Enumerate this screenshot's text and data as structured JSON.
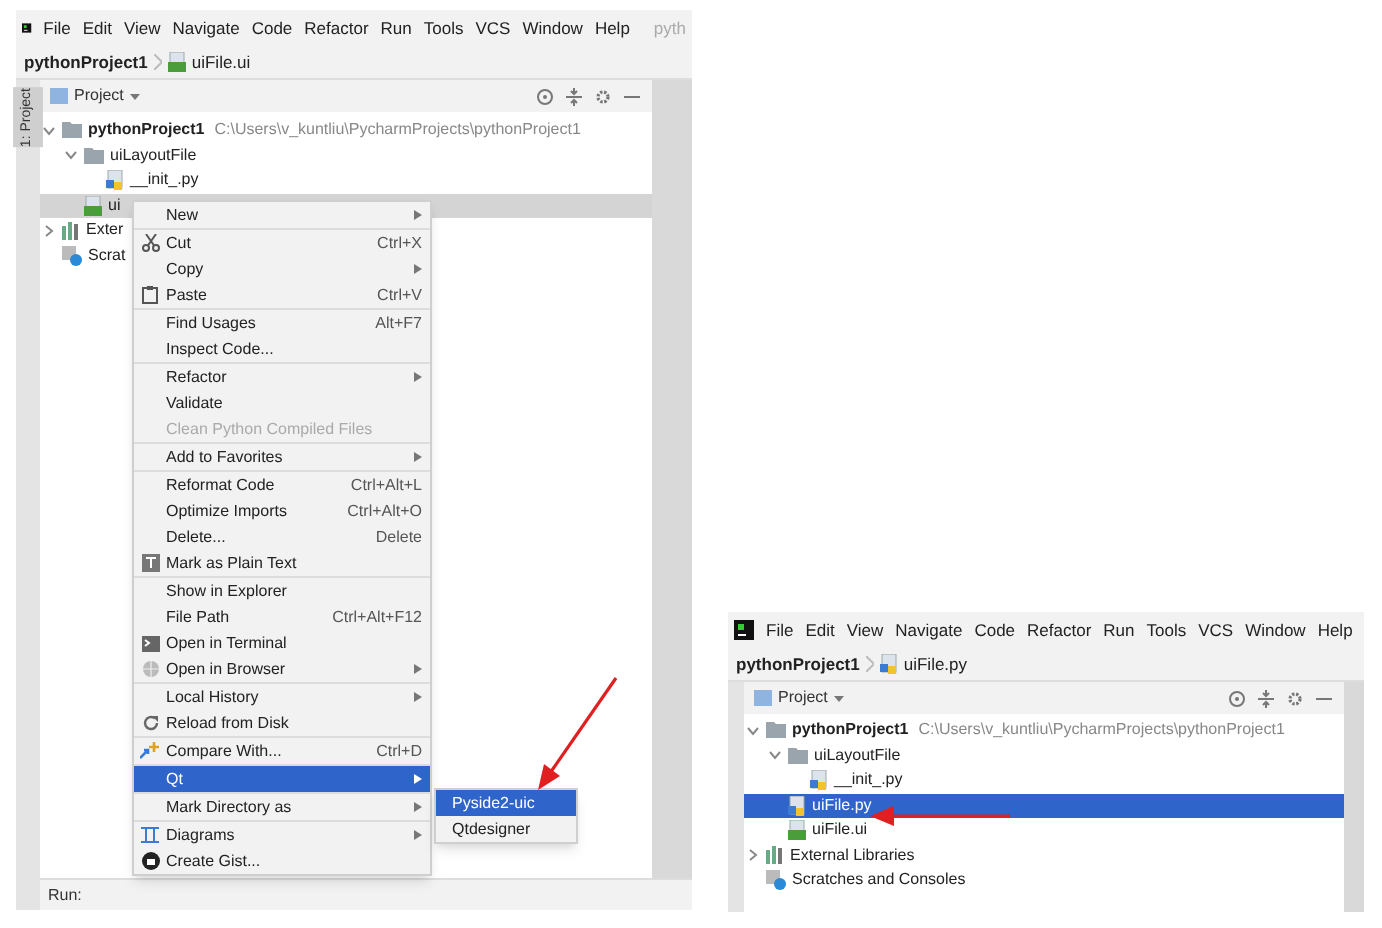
{
  "left_window": {
    "menu_bar": [
      "File",
      "Edit",
      "View",
      "Navigate",
      "Code",
      "Refactor",
      "Run",
      "Tools",
      "VCS",
      "Window",
      "Help",
      "pyth"
    ],
    "breadcrumb": {
      "project": "pythonProject1",
      "file": "uiFile.ui"
    },
    "side_tab": "1: Project",
    "panel_title": "Project",
    "tree": [
      {
        "label": "pythonProject1",
        "path": "C:\\Users\\v_kuntliu\\PycharmProjects\\pythonProject1",
        "kind": "folder",
        "expanded": true,
        "selected": false,
        "children": [
          {
            "label": "uiLayoutFile",
            "kind": "folder",
            "expanded": true,
            "selected": false,
            "children": [
              {
                "label": "__init_.py",
                "kind": "python",
                "selected": false
              }
            ]
          },
          {
            "label": "ui",
            "kind": "ui",
            "selected": true
          }
        ]
      },
      {
        "label": "Exter",
        "kind": "library",
        "expanded": false,
        "selected": false
      },
      {
        "label": "Scrat",
        "kind": "scratch",
        "selected": false
      }
    ],
    "context_menu": [
      [
        {
          "label": "New",
          "submenu": true,
          "disabled": false,
          "selected": false
        }
      ],
      [
        {
          "label": "Cut",
          "shortcut": "Ctrl+X",
          "kind": "scissors",
          "submenu": false,
          "disabled": false,
          "selected": false
        },
        {
          "label": "Copy",
          "submenu": true,
          "disabled": false,
          "selected": false
        },
        {
          "label": "Paste",
          "shortcut": "Ctrl+V",
          "kind": "clipboard",
          "submenu": false,
          "disabled": false,
          "selected": false
        }
      ],
      [
        {
          "label": "Find Usages",
          "shortcut": "Alt+F7",
          "submenu": false,
          "disabled": false,
          "selected": false
        },
        {
          "label": "Inspect Code...",
          "submenu": false,
          "disabled": false,
          "selected": false
        }
      ],
      [
        {
          "label": "Refactor",
          "submenu": true,
          "disabled": false,
          "selected": false
        },
        {
          "label": "Validate",
          "submenu": false,
          "disabled": false,
          "selected": false
        },
        {
          "label": "Clean Python Compiled Files",
          "submenu": false,
          "disabled": true,
          "selected": false
        }
      ],
      [
        {
          "label": "Add to Favorites",
          "submenu": true,
          "disabled": false,
          "selected": false
        }
      ],
      [
        {
          "label": "Reformat Code",
          "shortcut": "Ctrl+Alt+L",
          "submenu": false,
          "disabled": false,
          "selected": false
        },
        {
          "label": "Optimize Imports",
          "shortcut": "Ctrl+Alt+O",
          "submenu": false,
          "disabled": false,
          "selected": false
        },
        {
          "label": "Delete...",
          "shortcut": "Delete",
          "submenu": false,
          "disabled": false,
          "selected": false
        },
        {
          "label": "Mark as Plain Text",
          "kind": "text",
          "submenu": false,
          "disabled": false,
          "selected": false
        }
      ],
      [
        {
          "label": "Show in Explorer",
          "submenu": false,
          "disabled": false,
          "selected": false
        },
        {
          "label": "File Path",
          "shortcut": "Ctrl+Alt+F12",
          "submenu": false,
          "disabled": false,
          "selected": false
        },
        {
          "label": "Open in Terminal",
          "kind": "terminal",
          "submenu": false,
          "disabled": false,
          "selected": false
        },
        {
          "label": "Open in Browser",
          "kind": "globe",
          "submenu": true,
          "disabled": false,
          "selected": false
        }
      ],
      [
        {
          "label": "Local History",
          "submenu": true,
          "disabled": false,
          "selected": false
        },
        {
          "label": "Reload from Disk",
          "kind": "reload",
          "submenu": false,
          "disabled": false,
          "selected": false
        }
      ],
      [
        {
          "label": "Compare With...",
          "shortcut": "Ctrl+D",
          "kind": "compare",
          "submenu": false,
          "disabled": false,
          "selected": false
        }
      ],
      [
        {
          "label": "Qt",
          "submenu": true,
          "disabled": false,
          "selected": true
        }
      ],
      [
        {
          "label": "Mark Directory as",
          "submenu": true,
          "disabled": false,
          "selected": false
        }
      ],
      [
        {
          "label": "Diagrams",
          "kind": "diagram",
          "submenu": true,
          "disabled": false,
          "selected": false
        },
        {
          "label": "Create Gist...",
          "kind": "github",
          "submenu": false,
          "disabled": false,
          "selected": false
        }
      ]
    ],
    "submenu": [
      {
        "label": "Pyside2-uic",
        "selected": true
      },
      {
        "label": "Qtdesigner",
        "selected": false
      }
    ],
    "run_bar": "Run:"
  },
  "right_window": {
    "menu_bar": [
      "File",
      "Edit",
      "View",
      "Navigate",
      "Code",
      "Refactor",
      "Run",
      "Tools",
      "VCS",
      "Window",
      "Help"
    ],
    "breadcrumb": {
      "project": "pythonProject1",
      "file": "uiFile.py"
    },
    "panel_title": "Project",
    "tree": [
      {
        "label": "pythonProject1",
        "path": "C:\\Users\\v_kuntliu\\PycharmProjects\\pythonProject1",
        "kind": "folder",
        "expanded": true,
        "selected": false,
        "children": [
          {
            "label": "uiLayoutFile",
            "kind": "folder",
            "expanded": true,
            "selected": false,
            "children": [
              {
                "label": "__init_.py",
                "kind": "python",
                "selected": false
              }
            ]
          },
          {
            "label": "uiFile.py",
            "kind": "python",
            "selected": true
          },
          {
            "label": "uiFile.ui",
            "kind": "ui",
            "selected": false
          }
        ]
      },
      {
        "label": "External Libraries",
        "kind": "library",
        "expanded": false,
        "selected": false
      },
      {
        "label": "Scratches and Consoles",
        "kind": "scratch",
        "selected": false
      }
    ]
  }
}
